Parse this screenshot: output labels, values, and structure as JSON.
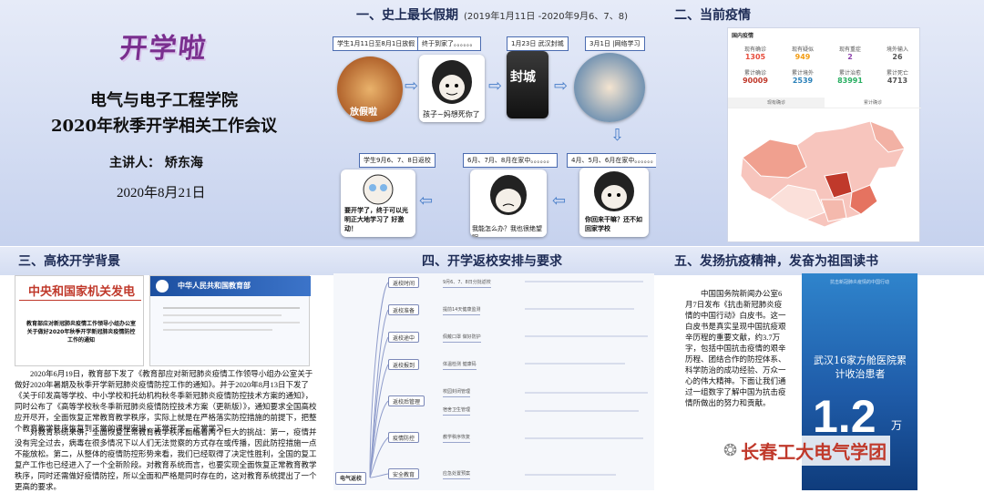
{
  "panel1": {
    "kaixue": "开学啦",
    "title1": "电气与电子工程学院",
    "title2": "2020年秋季开学相关工作会议",
    "speaker": "主讲人：  矫东海",
    "date": "2020年8月21日"
  },
  "panel2": {
    "title": "一、史上最长假期",
    "subtitle": "(2019年1月11日 -2020年9月6、7、8)",
    "labels": [
      "学生1月11日至8月1日放假",
      "终于到家了。。。。。。",
      "1月23日 武汉封城",
      "3月1日 |网络学习",
      "4月、5月、6月在家中。。。。。。",
      "6月、7月、8月在家中。。。。。。",
      "学生9月6、7、8日返校"
    ],
    "captions": [
      "放假啦",
      "孩子~妈想死你了~",
      "你回来干嘛？还不如回家学校",
      "我能怎么办？我也很绝望啊",
      "要开学了，终于可以光明正大地学习了 好激动！"
    ],
    "banner_text": "封城"
  },
  "panel3": {
    "title": "二、当前疫情",
    "app_title": "国内疫情",
    "stats_row1": [
      {
        "label": "现有确诊",
        "value": "1305",
        "color": "#e74c3c"
      },
      {
        "label": "现有疑似",
        "value": "949",
        "color": "#f39c12"
      },
      {
        "label": "现有重症",
        "value": "2",
        "color": "#8e44ad"
      },
      {
        "label": "境外输入",
        "value": "26",
        "color": "#555555"
      }
    ],
    "stats_row2": [
      {
        "label": "累计确诊",
        "value": "90009",
        "color": "#c0392b"
      },
      {
        "label": "累计境外",
        "value": "2539",
        "color": "#2980b9"
      },
      {
        "label": "累计治愈",
        "value": "83991",
        "color": "#27ae60"
      },
      {
        "label": "累计死亡",
        "value": "4713",
        "color": "#555555"
      }
    ],
    "tabs": [
      "现有确诊",
      "累计确诊"
    ]
  },
  "panel4": {
    "title": "三、高校开学背景",
    "doc1_header": "中央和国家机关发电",
    "doc1_body": "教育部应对新冠肺炎疫情工作领导小组办公室关于做好2020年秋季开学新冠肺炎疫情防控工作的通知",
    "doc2_header": "中华人民共和国教育部",
    "paragraph1": "2020年6月19日，教育部下发了《教育部应对新冠肺炎疫情工作领导小组办公室关于做好2020年暑期及秋季开学新冠肺炎疫情防控工作的通知》。并于2020年8月13日下发了《关于印发高等学校、中小学校和托幼机构秋冬季新冠肺炎疫情防控技术方案的通知》，同时公布了《高等学校秋冬季新冠肺炎疫情防控技术方案（更新版）》，通知要求全国高校应开尽开，全面恢复正常教育教学秩序，实际上就是在严格落实防控措施的前提下，把整个教育教学秩序恢复到正常的课程安排，正常开学，正常学习。",
    "paragraph2": "对教育系统来讲，全面恢复正常教育教学秩序面临着两个巨大的挑战：第一，疫情并没有完全过去，病毒在很多情况下以人们无法觉察的方式存在或传播，因此防控措施一点不能放松。第二，从整体的疫情防控形势来看，我们已经取得了决定性胜利，全国的复工复产工作也已经进入了一个全新阶段。对教育系统而言，也要实现全面恢复正常教育教学秩序，同时还需做好疫情防控，所以全面和严格是同时存在的，这对教育系统提出了一个更高的要求。"
  },
  "panel5": {
    "title": "四、开学返校安排与要求",
    "center": "电气返校",
    "branches": [
      "返校时间",
      "返校准备",
      "返校途中",
      "返校报到",
      "返校后管理",
      "疫情防控",
      "安全教育"
    ],
    "leaves": [
      "9月6、7、8日分批返校",
      "提前14天健康监测",
      "佩戴口罩 做好防护",
      "体温检测 健康码",
      "校园封闭管理",
      "宿舍卫生管理",
      "教学秩序恢复",
      "应急处置预案"
    ]
  },
  "panel6": {
    "title": "五、发扬抗疫精神，发奋为祖国读书",
    "text": "中国国务院新闻办公室6月7日发布《抗击新冠肺炎疫情的中国行动》白皮书。这一白皮书是真实呈现中国抗疫艰辛历程的重要文献，约3.7万字，包括中国抗击疫情的艰辛历程、团结合作的防控体系、科学防治的成功经验、万众一心的伟大精神。下面让我们通过一组数字了解中国为抗击疫情所做出的努力和贡献。",
    "book_top": "抗击新冠肺炎疫情的中国行动",
    "book_mid": "武汉16家方舱医院累计收治患者",
    "big_number": "1.2",
    "big_unit": "万",
    "small_unit": "人",
    "watermark": "长春工大电气学团",
    "watermark_color": "#c0392b"
  }
}
